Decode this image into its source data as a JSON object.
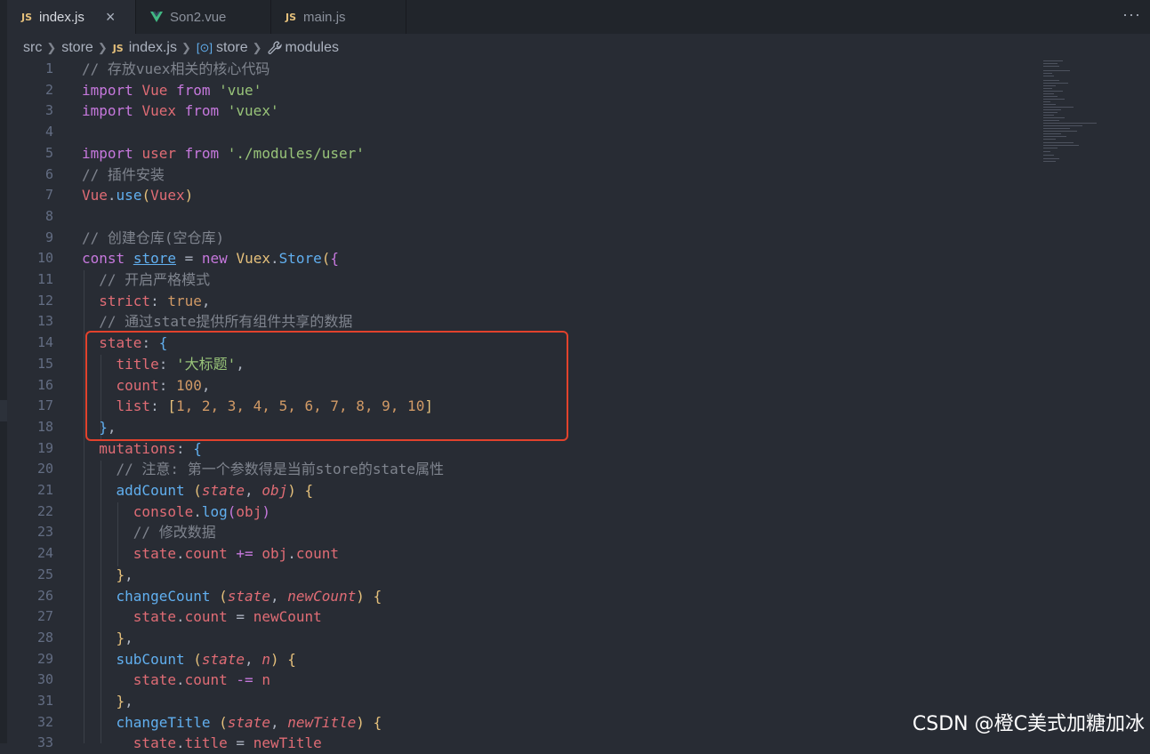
{
  "tabs": [
    {
      "label": "index.js",
      "icon": "js-file-icon",
      "icon_text": "JS",
      "active": true
    },
    {
      "label": "Son2.vue",
      "icon": "vue-file-icon",
      "active": false
    },
    {
      "label": "main.js",
      "icon": "js-file-icon",
      "icon_text": "JS",
      "active": false
    }
  ],
  "breadcrumb": {
    "items": [
      "src",
      "store",
      "index.js",
      "store",
      "modules"
    ],
    "js_icon_text": "JS"
  },
  "editor": {
    "line_numbers": [
      "1",
      "2",
      "3",
      "4",
      "5",
      "6",
      "7",
      "8",
      "9",
      "10",
      "11",
      "12",
      "13",
      "14",
      "15",
      "16",
      "17",
      "18",
      "19",
      "20",
      "21",
      "22",
      "23",
      "24",
      "25",
      "26",
      "27",
      "28",
      "29",
      "30",
      "31",
      "32",
      "33"
    ],
    "code_text": {
      "l1": "// 存放vuex相关的核心代码",
      "l2_kw1": "import",
      "l2_id": "Vue",
      "l2_kw2": "from",
      "l2_str": "'vue'",
      "l3_kw1": "import",
      "l3_id": "Vuex",
      "l3_kw2": "from",
      "l3_str": "'vuex'",
      "l5_kw1": "import",
      "l5_id": "user",
      "l5_kw2": "from",
      "l5_str": "'./modules/user'",
      "l6": "// 插件安装",
      "l7_obj": "Vue",
      "l7_fn": "use",
      "l7_arg": "Vuex",
      "l9": "// 创建仓库(空仓库)",
      "l10_kw": "const",
      "l10_var": "store",
      "l10_new": "new",
      "l10_cls": "Vuex",
      "l10_fn": "Store",
      "l11": "// 开启严格模式",
      "l12_key": "strict",
      "l12_val": "true",
      "l13": "// 通过state提供所有组件共享的数据",
      "l14_key": "state",
      "l15_key": "title",
      "l15_val": "'大标题'",
      "l16_key": "count",
      "l16_val": "100",
      "l17_key": "list",
      "l17_vals": "1, 2, 3, 4, 5, 6, 7, 8, 9, 10",
      "l19_key": "mutations",
      "l20": "// 注意: 第一个参数得是当前store的state属性",
      "l21_fn": "addCount",
      "l21_p1": "state",
      "l21_p2": "obj",
      "l22_obj": "console",
      "l22_fn": "log",
      "l22_arg": "obj",
      "l23": "// 修改数据",
      "l24_lhs": "state",
      "l24_prop": "count",
      "l24_op": "+=",
      "l24_obj": "obj",
      "l24_prop2": "count",
      "l26_fn": "changeCount",
      "l26_p1": "state",
      "l26_p2": "newCount",
      "l27_lhs": "state",
      "l27_prop": "count",
      "l27_op": "=",
      "l27_rhs": "newCount",
      "l29_fn": "subCount",
      "l29_p1": "state",
      "l29_p2": "n",
      "l30_lhs": "state",
      "l30_prop": "count",
      "l30_op": "-=",
      "l30_rhs": "n",
      "l32_fn": "changeTitle",
      "l32_p1": "state",
      "l32_p2": "newTitle",
      "l33_lhs": "state",
      "l33_prop": "title",
      "l33_op": "=",
      "l33_rhs": "newTitle"
    }
  },
  "watermark": "CSDN @橙C美式加糖加冰",
  "colors": {
    "highlight_box": "#e2422c",
    "background": "#282c34",
    "keyword": "#c678dd",
    "string": "#98c379",
    "comment": "#7f848e",
    "property": "#e06c75"
  }
}
